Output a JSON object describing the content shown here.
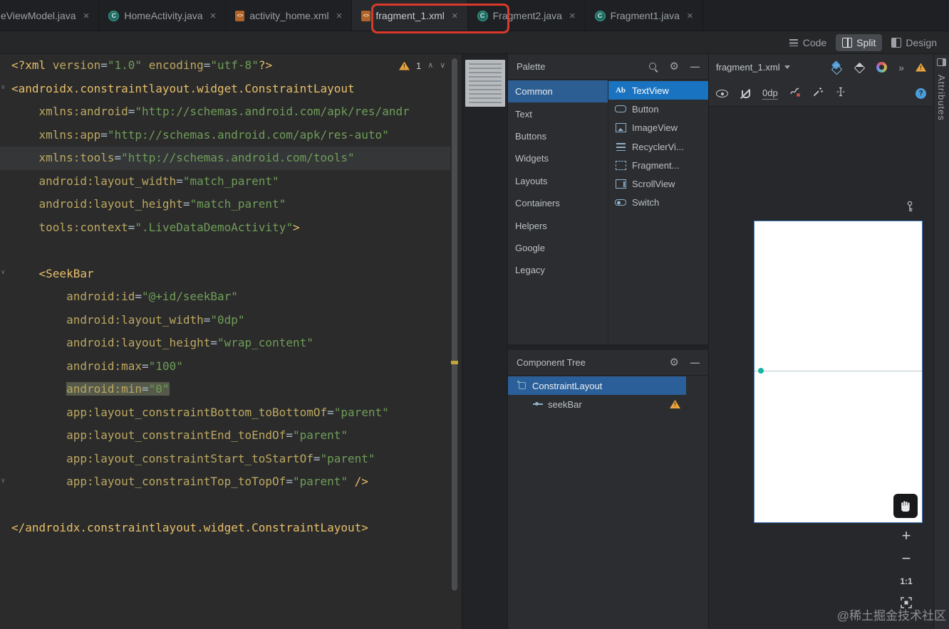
{
  "icons": {
    "close": "×",
    "gear": "⚙",
    "minimize": "—",
    "chevron_up": "∧",
    "chevron_down": "∨",
    "double_chevron": "»",
    "help": "?"
  },
  "tabs": [
    {
      "label": "eViewModel.java",
      "icon": "java-class",
      "selected": false,
      "clipped": true
    },
    {
      "label": "HomeActivity.java",
      "icon": "java-class",
      "selected": false
    },
    {
      "label": "activity_home.xml",
      "icon": "xml-file",
      "selected": false
    },
    {
      "label": "fragment_1.xml",
      "icon": "xml-file",
      "selected": true,
      "annotated": true
    },
    {
      "label": "Fragment2.java",
      "icon": "java-class",
      "selected": false
    },
    {
      "label": "Fragment1.java",
      "icon": "java-class",
      "selected": false
    }
  ],
  "mode_switcher": [
    {
      "label": "Code",
      "icon": "code",
      "selected": false
    },
    {
      "label": "Split",
      "icon": "split",
      "selected": true
    },
    {
      "label": "Design",
      "icon": "design",
      "selected": false
    }
  ],
  "editor": {
    "inspection_warning_count": "1",
    "lines": [
      {
        "t": [
          [
            "t",
            "<?xml "
          ],
          [
            "a",
            "version"
          ],
          [
            "p",
            "="
          ],
          [
            "v",
            "\"1.0\""
          ],
          [
            "p",
            " "
          ],
          [
            "a",
            "encoding"
          ],
          [
            "p",
            "="
          ],
          [
            "v",
            "\"utf-8\""
          ],
          [
            "t",
            "?>"
          ]
        ]
      },
      {
        "t": [
          [
            "t",
            "<androidx.constraintlayout.widget.ConstraintLayout"
          ]
        ]
      },
      {
        "t": [
          [
            "p",
            "    "
          ],
          [
            "a",
            "xmlns:android"
          ],
          [
            "p",
            "="
          ],
          [
            "v",
            "\"http://schemas.android.com/apk/res/andr"
          ]
        ]
      },
      {
        "t": [
          [
            "p",
            "    "
          ],
          [
            "a",
            "xmlns:app"
          ],
          [
            "p",
            "="
          ],
          [
            "v",
            "\"http://schemas.android.com/apk/res-auto\""
          ]
        ]
      },
      {
        "c": true,
        "t": [
          [
            "p",
            "    "
          ],
          [
            "a",
            "xmlns:tools"
          ],
          [
            "p",
            "="
          ],
          [
            "v",
            "\"http://schemas.android.com/tools\""
          ]
        ]
      },
      {
        "t": [
          [
            "p",
            "    "
          ],
          [
            "a",
            "android:layout_width"
          ],
          [
            "p",
            "="
          ],
          [
            "v",
            "\"match_parent\""
          ]
        ]
      },
      {
        "t": [
          [
            "p",
            "    "
          ],
          [
            "a",
            "android:layout_height"
          ],
          [
            "p",
            "="
          ],
          [
            "v",
            "\"match_parent\""
          ]
        ]
      },
      {
        "t": [
          [
            "p",
            "    "
          ],
          [
            "a",
            "tools:context"
          ],
          [
            "p",
            "="
          ],
          [
            "v",
            "\".LiveDataDemoActivity\""
          ],
          [
            "t",
            ">"
          ]
        ]
      },
      {
        "t": []
      },
      {
        "t": [
          [
            "p",
            "    "
          ],
          [
            "t",
            "<SeekBar"
          ]
        ]
      },
      {
        "t": [
          [
            "p",
            "        "
          ],
          [
            "a",
            "android:id"
          ],
          [
            "p",
            "="
          ],
          [
            "v",
            "\"@+id/seekBar\""
          ]
        ]
      },
      {
        "t": [
          [
            "p",
            "        "
          ],
          [
            "a",
            "android:layout_width"
          ],
          [
            "p",
            "="
          ],
          [
            "v",
            "\"0dp\""
          ]
        ]
      },
      {
        "t": [
          [
            "p",
            "        "
          ],
          [
            "a",
            "android:layout_height"
          ],
          [
            "p",
            "="
          ],
          [
            "v",
            "\"wrap_content\""
          ]
        ]
      },
      {
        "t": [
          [
            "p",
            "        "
          ],
          [
            "a",
            "android:max"
          ],
          [
            "p",
            "="
          ],
          [
            "v",
            "\"100\""
          ]
        ]
      },
      {
        "t": [
          [
            "p",
            "        "
          ],
          [
            "a",
            "android:min",
            "h"
          ],
          [
            "p",
            "=",
            "h"
          ],
          [
            "v",
            "\"0\"",
            "h"
          ]
        ]
      },
      {
        "t": [
          [
            "p",
            "        "
          ],
          [
            "a",
            "app:layout_constraintBottom_toBottomOf"
          ],
          [
            "p",
            "="
          ],
          [
            "v",
            "\"parent\""
          ]
        ]
      },
      {
        "t": [
          [
            "p",
            "        "
          ],
          [
            "a",
            "app:layout_constraintEnd_toEndOf"
          ],
          [
            "p",
            "="
          ],
          [
            "v",
            "\"parent\""
          ]
        ]
      },
      {
        "t": [
          [
            "p",
            "        "
          ],
          [
            "a",
            "app:layout_constraintStart_toStartOf"
          ],
          [
            "p",
            "="
          ],
          [
            "v",
            "\"parent\""
          ]
        ]
      },
      {
        "t": [
          [
            "p",
            "        "
          ],
          [
            "a",
            "app:layout_constraintTop_toTopOf"
          ],
          [
            "p",
            "="
          ],
          [
            "v",
            "\"parent\""
          ],
          [
            "t",
            " />"
          ]
        ]
      },
      {
        "t": []
      },
      {
        "t": [
          [
            "t",
            "</androidx.constraintlayout.widget.ConstraintLayout>"
          ]
        ]
      }
    ]
  },
  "palette": {
    "title": "Palette",
    "categories": [
      {
        "label": "Common",
        "selected": true
      },
      {
        "label": "Text",
        "selected": false
      },
      {
        "label": "Buttons",
        "selected": false
      },
      {
        "label": "Widgets",
        "selected": false
      },
      {
        "label": "Layouts",
        "selected": false
      },
      {
        "label": "Containers",
        "selected": false
      },
      {
        "label": "Helpers",
        "selected": false
      },
      {
        "label": "Google",
        "selected": false
      },
      {
        "label": "Legacy",
        "selected": false
      }
    ],
    "components": [
      {
        "label": "TextView",
        "icon": "textview",
        "selected": true
      },
      {
        "label": "Button",
        "icon": "button",
        "selected": false
      },
      {
        "label": "ImageView",
        "icon": "imageview",
        "selected": false
      },
      {
        "label": "RecyclerVi...",
        "icon": "recyclerview",
        "selected": false
      },
      {
        "label": "Fragment...",
        "icon": "fragment",
        "selected": false
      },
      {
        "label": "ScrollView",
        "icon": "scrollview",
        "selected": false
      },
      {
        "label": "Switch",
        "icon": "switch",
        "selected": false
      }
    ]
  },
  "component_tree": {
    "title": "Component Tree",
    "items": [
      {
        "label": "ConstraintLayout",
        "icon": "constraintlayout",
        "depth": 0,
        "selected": true,
        "warning": false
      },
      {
        "label": "seekBar",
        "icon": "seekbar",
        "depth": 1,
        "selected": false,
        "warning": true
      }
    ]
  },
  "design": {
    "file_selector": "fragment_1.xml",
    "default_margin": "0dp",
    "zoom_in": "+",
    "zoom_out": "−",
    "zoom_actual": "1:1",
    "attributes_panel_label": "Attributes"
  },
  "watermark": "@稀土掘金技术社区"
}
